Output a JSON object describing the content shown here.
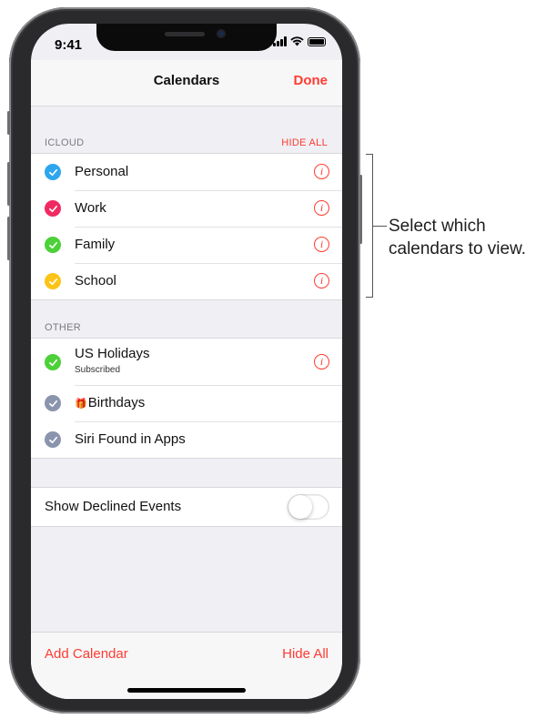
{
  "status_bar": {
    "time": "9:41"
  },
  "nav": {
    "title": "Calendars",
    "done": "Done"
  },
  "icloud": {
    "header": "ICLOUD",
    "action": "HIDE ALL",
    "items": [
      {
        "label": "Personal",
        "color": "#2da6ee",
        "checked": true
      },
      {
        "label": "Work",
        "color": "#f02a61",
        "checked": true
      },
      {
        "label": "Family",
        "color": "#4cd138",
        "checked": true
      },
      {
        "label": "School",
        "color": "#fbc417",
        "checked": true
      }
    ]
  },
  "other": {
    "header": "OTHER",
    "items": [
      {
        "label": "US Holidays",
        "sublabel": "Subscribed",
        "color": "#4cd138",
        "checked": true,
        "has_info": true
      },
      {
        "label": "Birthdays",
        "icon": "gift-icon",
        "color": "#8a94ad",
        "checked": true
      },
      {
        "label": "Siri Found in Apps",
        "color": "#8a94ad",
        "checked": true
      }
    ]
  },
  "settings": {
    "show_declined_label": "Show Declined Events",
    "show_declined_on": false
  },
  "bottom": {
    "add_calendar": "Add Calendar",
    "hide_all": "Hide All"
  },
  "callout": {
    "line1": "Select which",
    "line2": "calendars to view."
  },
  "colors": {
    "accent": "#ff3b30",
    "background": "#efeff4"
  }
}
